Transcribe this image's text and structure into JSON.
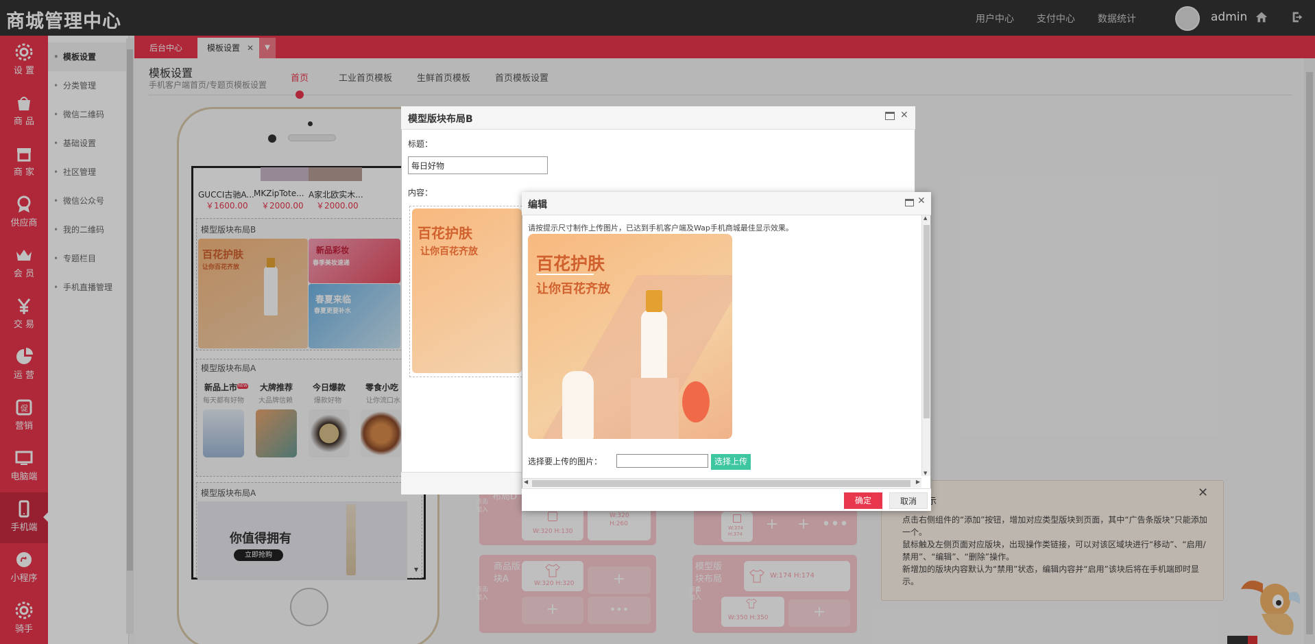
{
  "brand": "商城管理中心",
  "topnav": [
    "用户中心",
    "支付中心",
    "数据统计"
  ],
  "user": {
    "name": "admin"
  },
  "rail": [
    {
      "label": "设 置",
      "icon": "gear-icon"
    },
    {
      "label": "商 品",
      "icon": "bag-icon"
    },
    {
      "label": "商 家",
      "icon": "store-icon"
    },
    {
      "label": "供应商",
      "icon": "badge-icon"
    },
    {
      "label": "会 员",
      "icon": "crown-icon"
    },
    {
      "label": "交 易",
      "icon": "yen-icon"
    },
    {
      "label": "运 营",
      "icon": "pie-icon"
    },
    {
      "label": "营销",
      "icon": "promo-icon"
    },
    {
      "label": "电脑端",
      "icon": "monitor-icon"
    },
    {
      "label": "手机端",
      "icon": "phone-icon"
    },
    {
      "label": "小程序",
      "icon": "miniapp-icon"
    },
    {
      "label": "骑手",
      "icon": "rider-icon"
    }
  ],
  "subnav": [
    "模板设置",
    "分类管理",
    "微信二维码",
    "基础设置",
    "社区管理",
    "微信公众号",
    "我的二维码",
    "专题栏目",
    "手机直播管理"
  ],
  "tabs": {
    "home": "后台中心",
    "current": "模板设置"
  },
  "page": {
    "title": "模板设置",
    "subtitle": "手机客户端首页/专题页模板设置",
    "tabs": [
      "首页",
      "工业首页模板",
      "生鲜首页模板",
      "首页模板设置"
    ]
  },
  "phone": {
    "products": [
      {
        "name": "GUCCI古驰A...",
        "price": "￥1600.00"
      },
      {
        "name": "MKZipTote...",
        "price": "￥2000.00"
      },
      {
        "name": "A家北欧实木...",
        "price": "￥2000.00"
      }
    ],
    "blockB": "模型版块布局B",
    "blockA1": "模型版块布局A",
    "blockA2": "模型版块布局A",
    "bigCard": {
      "t1": "百花护肤",
      "t2": "让你百花齐放"
    },
    "sideCards": [
      {
        "t1": "新品彩妆",
        "t2": "春季美妆速递"
      },
      {
        "t1": "春夏来临",
        "t2": "春夏更要补水"
      }
    ],
    "cats": [
      {
        "title": "新品上市",
        "sub": "每天都有好物",
        "tag": "NEW"
      },
      {
        "title": "大牌推荐",
        "sub": "大品牌信赖"
      },
      {
        "title": "今日爆款",
        "sub": "爆款好物"
      },
      {
        "title": "零食小吃",
        "sub": "让你流口水"
      }
    ],
    "banner": {
      "text": "你值得拥有",
      "btn": "立即抢购"
    }
  },
  "rightBlocks": {
    "b1": {
      "title": "商品版块A",
      "side": "点击加入",
      "dims": "W:320 H:320"
    },
    "b2": {
      "title": "模型版块布局F",
      "side": "点击加入",
      "dims1": "W:174   H:174",
      "dims2": "W:350   H:350"
    },
    "b3": {
      "title": "布局D",
      "side": "点击加入",
      "dims1": "W:320 H:130",
      "dims2": "W:320 H:260"
    },
    "b4": {
      "dims": "W:374 H:374"
    }
  },
  "tip": {
    "title": "示",
    "lines": [
      "点击右侧组件的“添加”按钮，增加对应类型版块到页面，其中“广告条版块”只能添加一个。",
      "鼠标触及左侧页面对应版块，出现操作类链接，可以对该区域块进行“移动”、“启用/禁用”、“编辑”、“删除”操作。",
      "新增加的版块内容默认为“禁用”状态，编辑内容并“启用”该块后将在手机端即时显示。"
    ]
  },
  "modalB": {
    "title": "模型版块布局B",
    "label_title": "标题：",
    "title_value": "每日好物",
    "label_content": "内容："
  },
  "modalEdit": {
    "title": "编辑",
    "tip": "请按提示尺寸制作上传图片，已达到手机客户端及Wap手机商城最佳显示效果。",
    "image": {
      "t1": "百花护肤",
      "t2": "让你百花齐放"
    },
    "upload_label": "选择要上传的图片：",
    "upload_btn": "选择上传",
    "ok": "确定",
    "cancel": "取消"
  },
  "colors": {
    "accent": "#e8364d",
    "topbar": "#333333",
    "upload": "#3ec6a0"
  }
}
